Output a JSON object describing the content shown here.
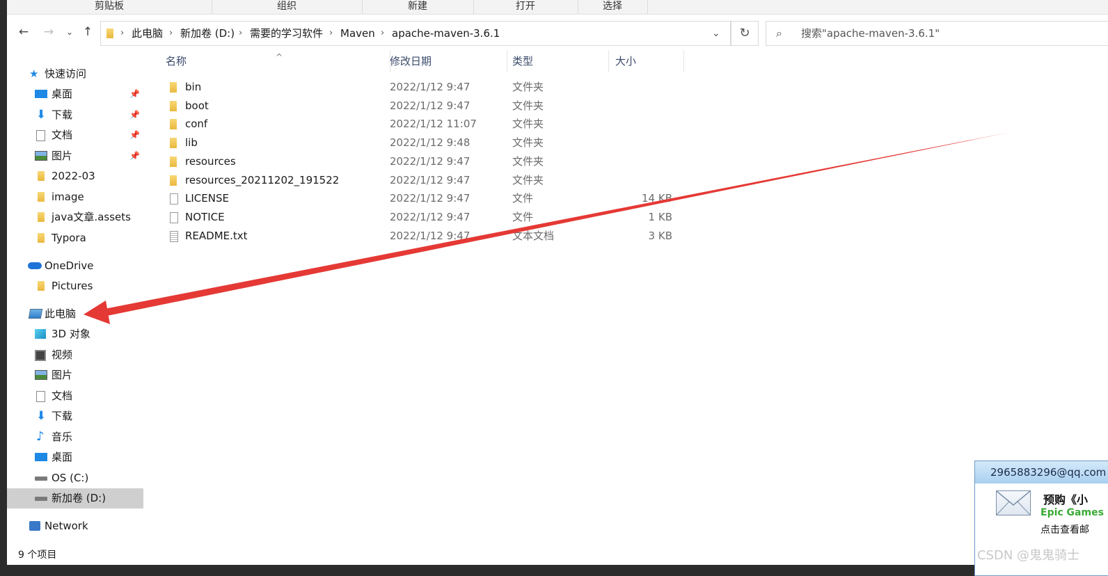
{
  "ribbon": {
    "groups": [
      "剪贴板",
      "组织",
      "新建",
      "打开",
      "选择"
    ]
  },
  "breadcrumb": [
    "此电脑",
    "新加卷 (D:)",
    "需要的学习软件",
    "Maven",
    "apache-maven-3.6.1"
  ],
  "search": {
    "placeholder": "搜索\"apache-maven-3.6.1\""
  },
  "nav": {
    "quick_access": "快速访问",
    "quick_items": [
      "桌面",
      "下载",
      "文档",
      "图片",
      "2022-03",
      "image",
      "java文章.assets",
      "Typora"
    ],
    "onedrive": "OneDrive",
    "onedrive_items": [
      "Pictures"
    ],
    "this_pc": "此电脑",
    "pc_items": [
      "3D 对象",
      "视频",
      "图片",
      "文档",
      "下载",
      "音乐",
      "桌面",
      "OS (C:)",
      "新加卷 (D:)"
    ],
    "network": "Network"
  },
  "columns": {
    "name": "名称",
    "date": "修改日期",
    "type": "类型",
    "size": "大小"
  },
  "files": [
    {
      "name": "bin",
      "date": "2022/1/12 9:47",
      "type": "文件夹",
      "size": "",
      "icon": "folder"
    },
    {
      "name": "boot",
      "date": "2022/1/12 9:47",
      "type": "文件夹",
      "size": "",
      "icon": "folder"
    },
    {
      "name": "conf",
      "date": "2022/1/12 11:07",
      "type": "文件夹",
      "size": "",
      "icon": "folder"
    },
    {
      "name": "lib",
      "date": "2022/1/12 9:48",
      "type": "文件夹",
      "size": "",
      "icon": "folder"
    },
    {
      "name": "resources",
      "date": "2022/1/12 9:47",
      "type": "文件夹",
      "size": "",
      "icon": "folder"
    },
    {
      "name": "resources_20211202_191522",
      "date": "2022/1/12 9:47",
      "type": "文件夹",
      "size": "",
      "icon": "folder"
    },
    {
      "name": "LICENSE",
      "date": "2022/1/12 9:47",
      "type": "文件",
      "size": "14 KB",
      "icon": "file"
    },
    {
      "name": "NOTICE",
      "date": "2022/1/12 9:47",
      "type": "文件",
      "size": "1 KB",
      "icon": "file"
    },
    {
      "name": "README.txt",
      "date": "2022/1/12 9:47",
      "type": "文本文档",
      "size": "3 KB",
      "icon": "txt"
    }
  ],
  "status": {
    "count": "9 个项目"
  },
  "notification": {
    "email": "2965883296@qq.com",
    "title": "预购《小",
    "subtitle": "Epic Games",
    "hint": "点击查看邮"
  },
  "watermark": "CSDN @鬼鬼骑士",
  "colors": {
    "arrow": "#e53935",
    "folder": "#eab93f",
    "accent": "#1e88e5"
  }
}
